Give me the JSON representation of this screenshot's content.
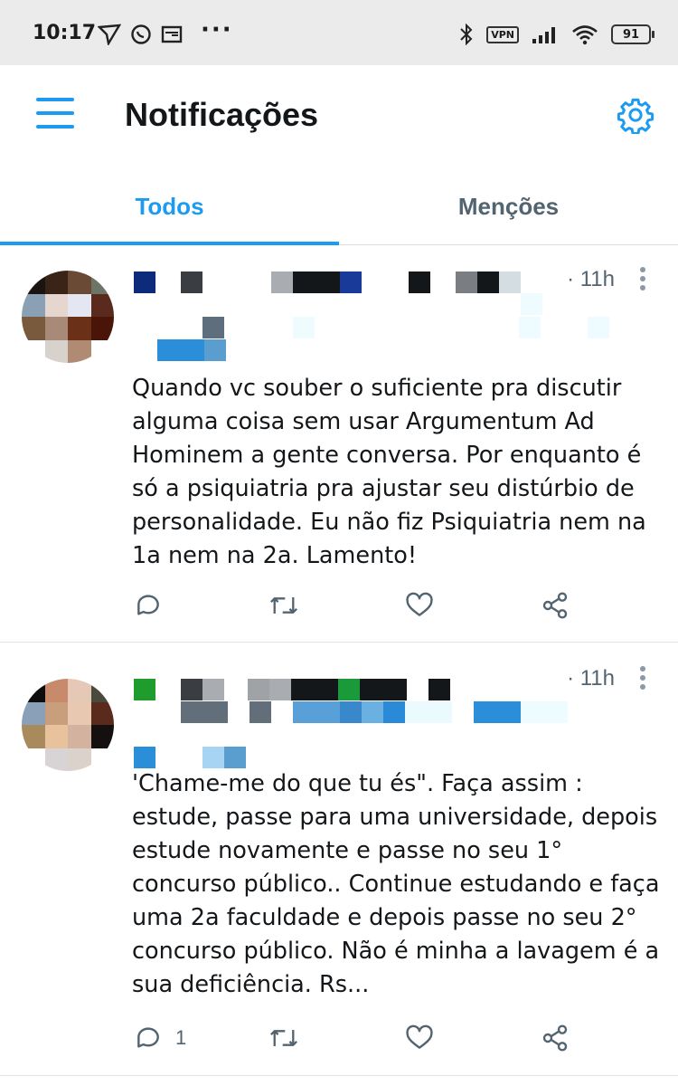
{
  "status_bar": {
    "time": "10:17",
    "vpn": "VPN",
    "battery": "91",
    "more": "···"
  },
  "header": {
    "title": "Notificações",
    "menu_icon": "hamburger-menu-icon",
    "settings_icon": "gear-icon"
  },
  "tabs": [
    {
      "label": "Todos",
      "active": true
    },
    {
      "label": "Menções",
      "active": false
    }
  ],
  "tweets": [
    {
      "time": "· 11h",
      "text": "Quando vc souber o suficiente pra discutir alguma coisa sem usar Argumentum Ad Hominem a gente conversa. Por enquanto é só a psiquiatria pra ajustar seu distúrbio de personalidade. Eu não fiz Psiquiatria nem na 1a nem na 2a. Lamento!",
      "reply_count": ""
    },
    {
      "time": "· 11h",
      "text": "'Chame-me do que tu és\". Faça assim : estude, passe para uma universidade, depois estude novamente e passe no seu 1° concurso público.. Continue estudando e faça uma 2a faculdade e depois passe no seu 2° concurso público. Não é minha a lavagem é a sua deficiência. Rs...",
      "reply_count": "1"
    }
  ],
  "colors": {
    "accent": "#1d9bf0",
    "secondary_text": "#536471",
    "divider": "#e1e4e6"
  }
}
